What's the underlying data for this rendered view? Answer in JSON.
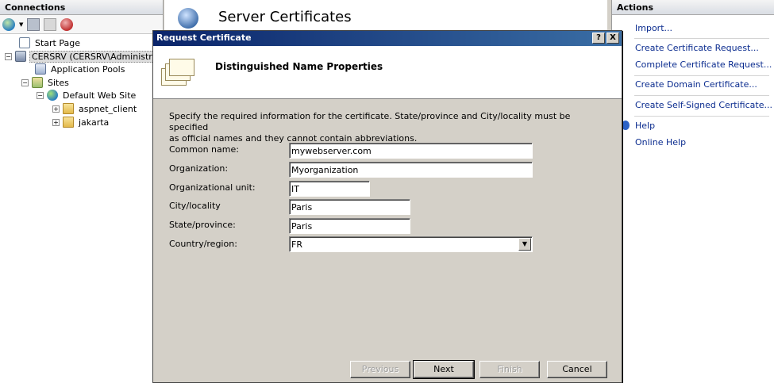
{
  "connections": {
    "header": "Connections",
    "tree": [
      {
        "label": "Start Page"
      },
      {
        "label": "CERSRV (CERSRV\\Administrat"
      },
      {
        "label": "Application Pools"
      },
      {
        "label": "Sites"
      },
      {
        "label": "Default Web Site"
      },
      {
        "label": "aspnet_client"
      },
      {
        "label": "jakarta"
      }
    ]
  },
  "center": {
    "title": "Server Certificates"
  },
  "actions": {
    "header": "Actions",
    "items": [
      "Import...",
      "Create Certificate Request...",
      "Complete Certificate Request...",
      "Create Domain Certificate...",
      "Create Self-Signed Certificate...",
      "Help",
      "Online Help"
    ]
  },
  "dialog": {
    "title": "Request Certificate",
    "help_btn": "?",
    "close_btn": "X",
    "header_title": "Distinguished Name Properties",
    "instructions_line1": "Specify the required information for the certificate. State/province and City/locality must be specified",
    "instructions_line2": "as official names and they cannot contain abbreviations.",
    "fields": {
      "common_name": {
        "label": "Common name:",
        "value": "mywebserver.com"
      },
      "organization": {
        "label": "Organization:",
        "value": "Myorganization"
      },
      "org_unit": {
        "label": "Organizational unit:",
        "value": "IT"
      },
      "city": {
        "label": "City/locality",
        "value": "Paris"
      },
      "state": {
        "label": "State/province:",
        "value": "Paris"
      },
      "country": {
        "label": "Country/region:",
        "value": "FR"
      }
    },
    "buttons": {
      "previous": "Previous",
      "next": "Next",
      "finish": "Finish",
      "cancel": "Cancel"
    }
  }
}
